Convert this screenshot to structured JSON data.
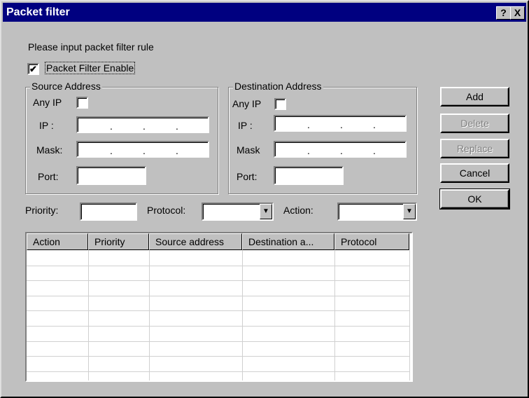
{
  "window": {
    "title": "Packet filter",
    "help_button": "?",
    "close_button": "X"
  },
  "instruction": "Please input packet filter rule",
  "enable": {
    "label": "Packet Filter Enable",
    "checked": true,
    "mark": "✔"
  },
  "source": {
    "legend": "Source Address",
    "any_ip_label": "Any IP",
    "ip_label": "IP :",
    "mask_label": "Mask:",
    "port_label": "Port:",
    "ip_value": "",
    "mask_value": "",
    "port_value": ""
  },
  "destination": {
    "legend": "Destination Address",
    "any_ip_label": "Any IP",
    "ip_label": "IP :",
    "mask_label": "Mask",
    "port_label": "Port:",
    "ip_value": "",
    "mask_value": "",
    "port_value": ""
  },
  "buttons": {
    "add": "Add",
    "delete": "Delete",
    "replace": "Replace",
    "cancel": "Cancel",
    "ok": "OK"
  },
  "options": {
    "priority_label": "Priority:",
    "protocol_label": "Protocol:",
    "action_label": "Action:",
    "priority_value": "",
    "protocol_value": "",
    "action_value": "",
    "dropdown_arrow": "▼"
  },
  "table": {
    "columns": [
      "Action",
      "Priority",
      "Source address",
      "Destination a...",
      "Protocol"
    ],
    "rows": []
  }
}
